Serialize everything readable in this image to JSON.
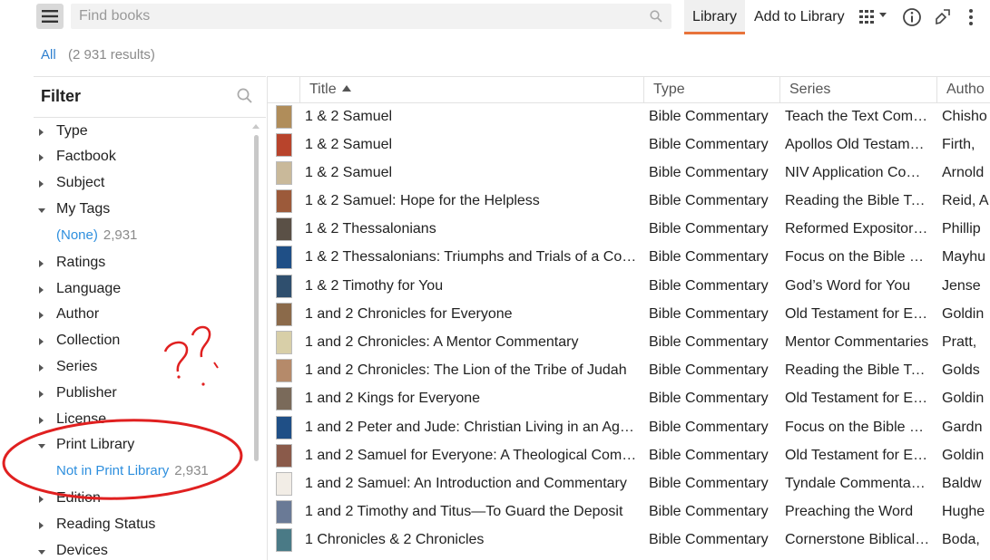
{
  "toolbar": {
    "search_placeholder": "Find books",
    "tabs": [
      "Library",
      "Add to Library"
    ]
  },
  "results": {
    "all_label": "All",
    "count": "(2 931 results)"
  },
  "filter": {
    "title": "Filter",
    "items": [
      {
        "label": "Type",
        "expanded": false
      },
      {
        "label": "Factbook",
        "expanded": false
      },
      {
        "label": "Subject",
        "expanded": false
      },
      {
        "label": "My Tags",
        "expanded": true,
        "sub_value": "(None)",
        "sub_count": "2,931"
      },
      {
        "label": "Ratings",
        "expanded": false
      },
      {
        "label": "Language",
        "expanded": false
      },
      {
        "label": "Author",
        "expanded": false
      },
      {
        "label": "Collection",
        "expanded": false
      },
      {
        "label": "Series",
        "expanded": false
      },
      {
        "label": "Publisher",
        "expanded": false
      },
      {
        "label": "License",
        "expanded": false
      },
      {
        "label": "Print Library",
        "expanded": true,
        "sub_value": "Not in Print Library",
        "sub_count": "2,931"
      },
      {
        "label": "Edition",
        "expanded": false
      },
      {
        "label": "Reading Status",
        "expanded": false
      },
      {
        "label": "Devices",
        "expanded": true
      }
    ]
  },
  "columns": [
    "Title",
    "Type",
    "Series",
    "Autho"
  ],
  "rows": [
    {
      "title": "1 & 2 Samuel",
      "type": "Bible Commentary",
      "series": "Teach the Text Com…",
      "author": "Chisho",
      "cover": "#b08d5a"
    },
    {
      "title": "1 & 2 Samuel",
      "type": "Bible Commentary",
      "series": "Apollos Old Testame…",
      "author": "Firth, ",
      "cover": "#b8442c"
    },
    {
      "title": "1 & 2 Samuel",
      "type": "Bible Commentary",
      "series": "NIV Application Com…",
      "author": "Arnold",
      "cover": "#c9b99a"
    },
    {
      "title": "1 & 2 Samuel: Hope for the Helpless",
      "type": "Bible Commentary",
      "series": "Reading the Bible To…",
      "author": "Reid, A",
      "cover": "#9c5a3a"
    },
    {
      "title": "1 & 2 Thessalonians",
      "type": "Bible Commentary",
      "series": "Reformed Expository…",
      "author": "Phillip",
      "cover": "#5a5046"
    },
    {
      "title": "1 & 2 Thessalonians: Triumphs and Trials of a Cons…",
      "type": "Bible Commentary",
      "series": "Focus on the Bible C…",
      "author": "Mayhu",
      "cover": "#1f4f86"
    },
    {
      "title": "1 & 2 Timothy for You",
      "type": "Bible Commentary",
      "series": "God’s Word for You",
      "author": "Jense",
      "cover": "#2f4f6e"
    },
    {
      "title": "1 and 2 Chronicles for Everyone",
      "type": "Bible Commentary",
      "series": "Old Testament for Ev…",
      "author": "Goldin",
      "cover": "#8b6a4a"
    },
    {
      "title": "1 and 2 Chronicles: A Mentor Commentary",
      "type": "Bible Commentary",
      "series": "Mentor Commentaries",
      "author": "Pratt, ",
      "cover": "#d8cfa8"
    },
    {
      "title": "1 and 2 Chronicles: The Lion of the Tribe of Judah",
      "type": "Bible Commentary",
      "series": "Reading the Bible To…",
      "author": "Golds",
      "cover": "#b58a6a"
    },
    {
      "title": "1 and 2 Kings for Everyone",
      "type": "Bible Commentary",
      "series": "Old Testament for Ev…",
      "author": "Goldin",
      "cover": "#7a6a5a"
    },
    {
      "title": "1 and 2 Peter and Jude: Christian Living in an Age …",
      "type": "Bible Commentary",
      "series": "Focus on the Bible C…",
      "author": "Gardn",
      "cover": "#1f4f86"
    },
    {
      "title": "1 and 2 Samuel for Everyone: A Theological Comm…",
      "type": "Bible Commentary",
      "series": "Old Testament for Ev…",
      "author": "Goldin",
      "cover": "#8a5a4a"
    },
    {
      "title": "1 and 2 Samuel: An Introduction and Commentary",
      "type": "Bible Commentary",
      "series": "Tyndale Commentaries",
      "author": "Baldw",
      "cover": "#f2ede6"
    },
    {
      "title": "1 and 2 Timothy and Titus—To Guard the Deposit",
      "type": "Bible Commentary",
      "series": "Preaching the Word",
      "author": "Hughe",
      "cover": "#6a7a96"
    },
    {
      "title": "1 Chronicles & 2 Chronicles",
      "type": "Bible Commentary",
      "series": "Cornerstone Biblical …",
      "author": "Boda, ",
      "cover": "#4a7a86"
    }
  ],
  "annotation": {
    "scribble": "??"
  }
}
